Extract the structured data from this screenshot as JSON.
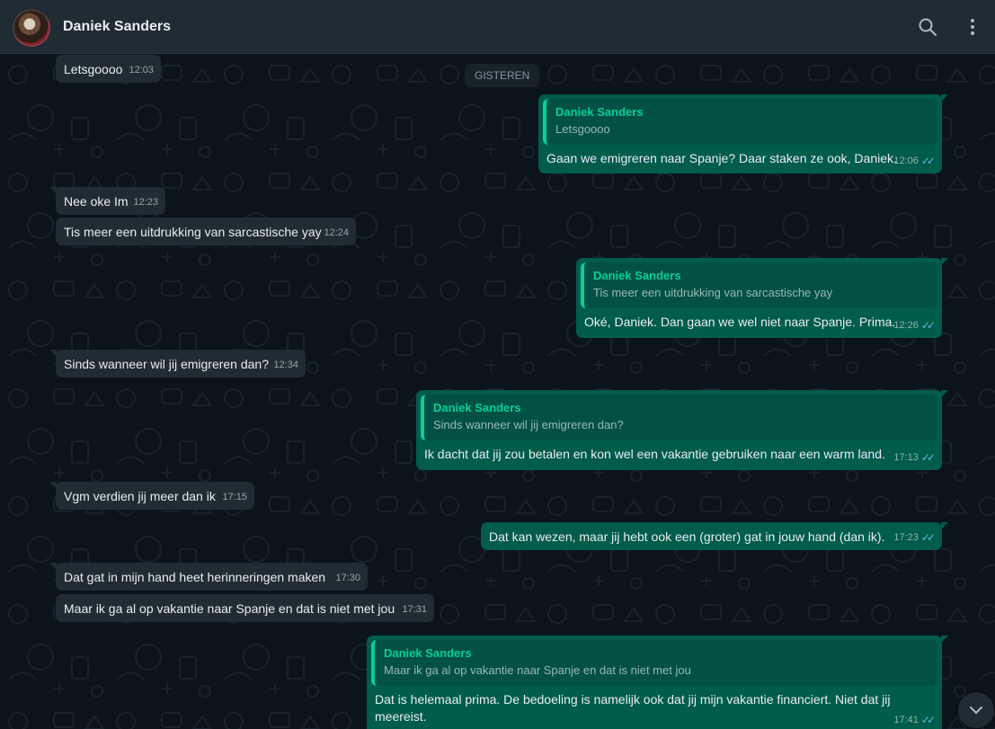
{
  "header": {
    "contact_name": "Daniek Sanders",
    "icons": {
      "search": "search-icon",
      "menu": "kebab-menu-icon",
      "avatar": "contact-avatar"
    }
  },
  "chat": {
    "date_separator": "GISTEREN",
    "messages": [
      {
        "dir": "in",
        "text": "Letsgoooo",
        "time": "12:03"
      },
      {
        "dir": "out",
        "quote": {
          "author": "Daniek Sanders",
          "text": "Letsgoooo"
        },
        "text": "Gaan we emigreren naar Spanje? Daar staken ze ook, Daniek.",
        "time": "12:06",
        "status": "read"
      },
      {
        "dir": "in",
        "text": "Nee oke Im",
        "time": "12:23"
      },
      {
        "dir": "in",
        "text": "Tis meer een uitdrukking van sarcastische yay",
        "time": "12:24"
      },
      {
        "dir": "out",
        "quote": {
          "author": "Daniek Sanders",
          "text": "Tis meer een uitdrukking van sarcastische yay"
        },
        "text": "Oké, Daniek. Dan gaan we wel niet naar Spanje. Prima.",
        "time": "12:26",
        "status": "read"
      },
      {
        "dir": "in",
        "text": "Sinds wanneer wil jij emigreren dan?",
        "time": "12:34"
      },
      {
        "dir": "out",
        "quote": {
          "author": "Daniek Sanders",
          "text": "Sinds wanneer wil jij emigreren dan?"
        },
        "text": "Ik dacht dat jij zou betalen en kon wel een vakantie gebruiken naar een warm land.",
        "time": "17:13",
        "status": "read"
      },
      {
        "dir": "in",
        "text": "Vgm verdien jij meer dan ik",
        "time": "17:15"
      },
      {
        "dir": "out",
        "text": "Dat kan wezen, maar jij hebt ook een (groter) gat in jouw hand (dan ik).",
        "time": "17:23",
        "status": "read"
      },
      {
        "dir": "in",
        "text": "Dat gat in mijn hand heet herinneringen maken",
        "time": "17:30"
      },
      {
        "dir": "in",
        "text": "Maar ik ga al op vakantie naar Spanje en dat is niet met jou",
        "time": "17:31"
      },
      {
        "dir": "out",
        "quote": {
          "author": "Daniek Sanders",
          "text": "Maar ik ga al op vakantie naar Spanje en dat is niet met jou"
        },
        "text": "Dat is helemaal prima. De bedoeling is namelijk ook dat jij mijn vakantie financiert. Niet dat jij meereist.",
        "time": "17:41",
        "status": "read"
      }
    ],
    "read_ticks": "✓✓",
    "scroll_button_icon": "chevron-down-icon"
  },
  "colors": {
    "background": "#0b141a",
    "header": "#202c33",
    "incoming_bubble": "#202c33",
    "outgoing_bubble": "#005c4b",
    "quote_accent": "#06cf9c",
    "read_ticks": "#53bdeb"
  }
}
